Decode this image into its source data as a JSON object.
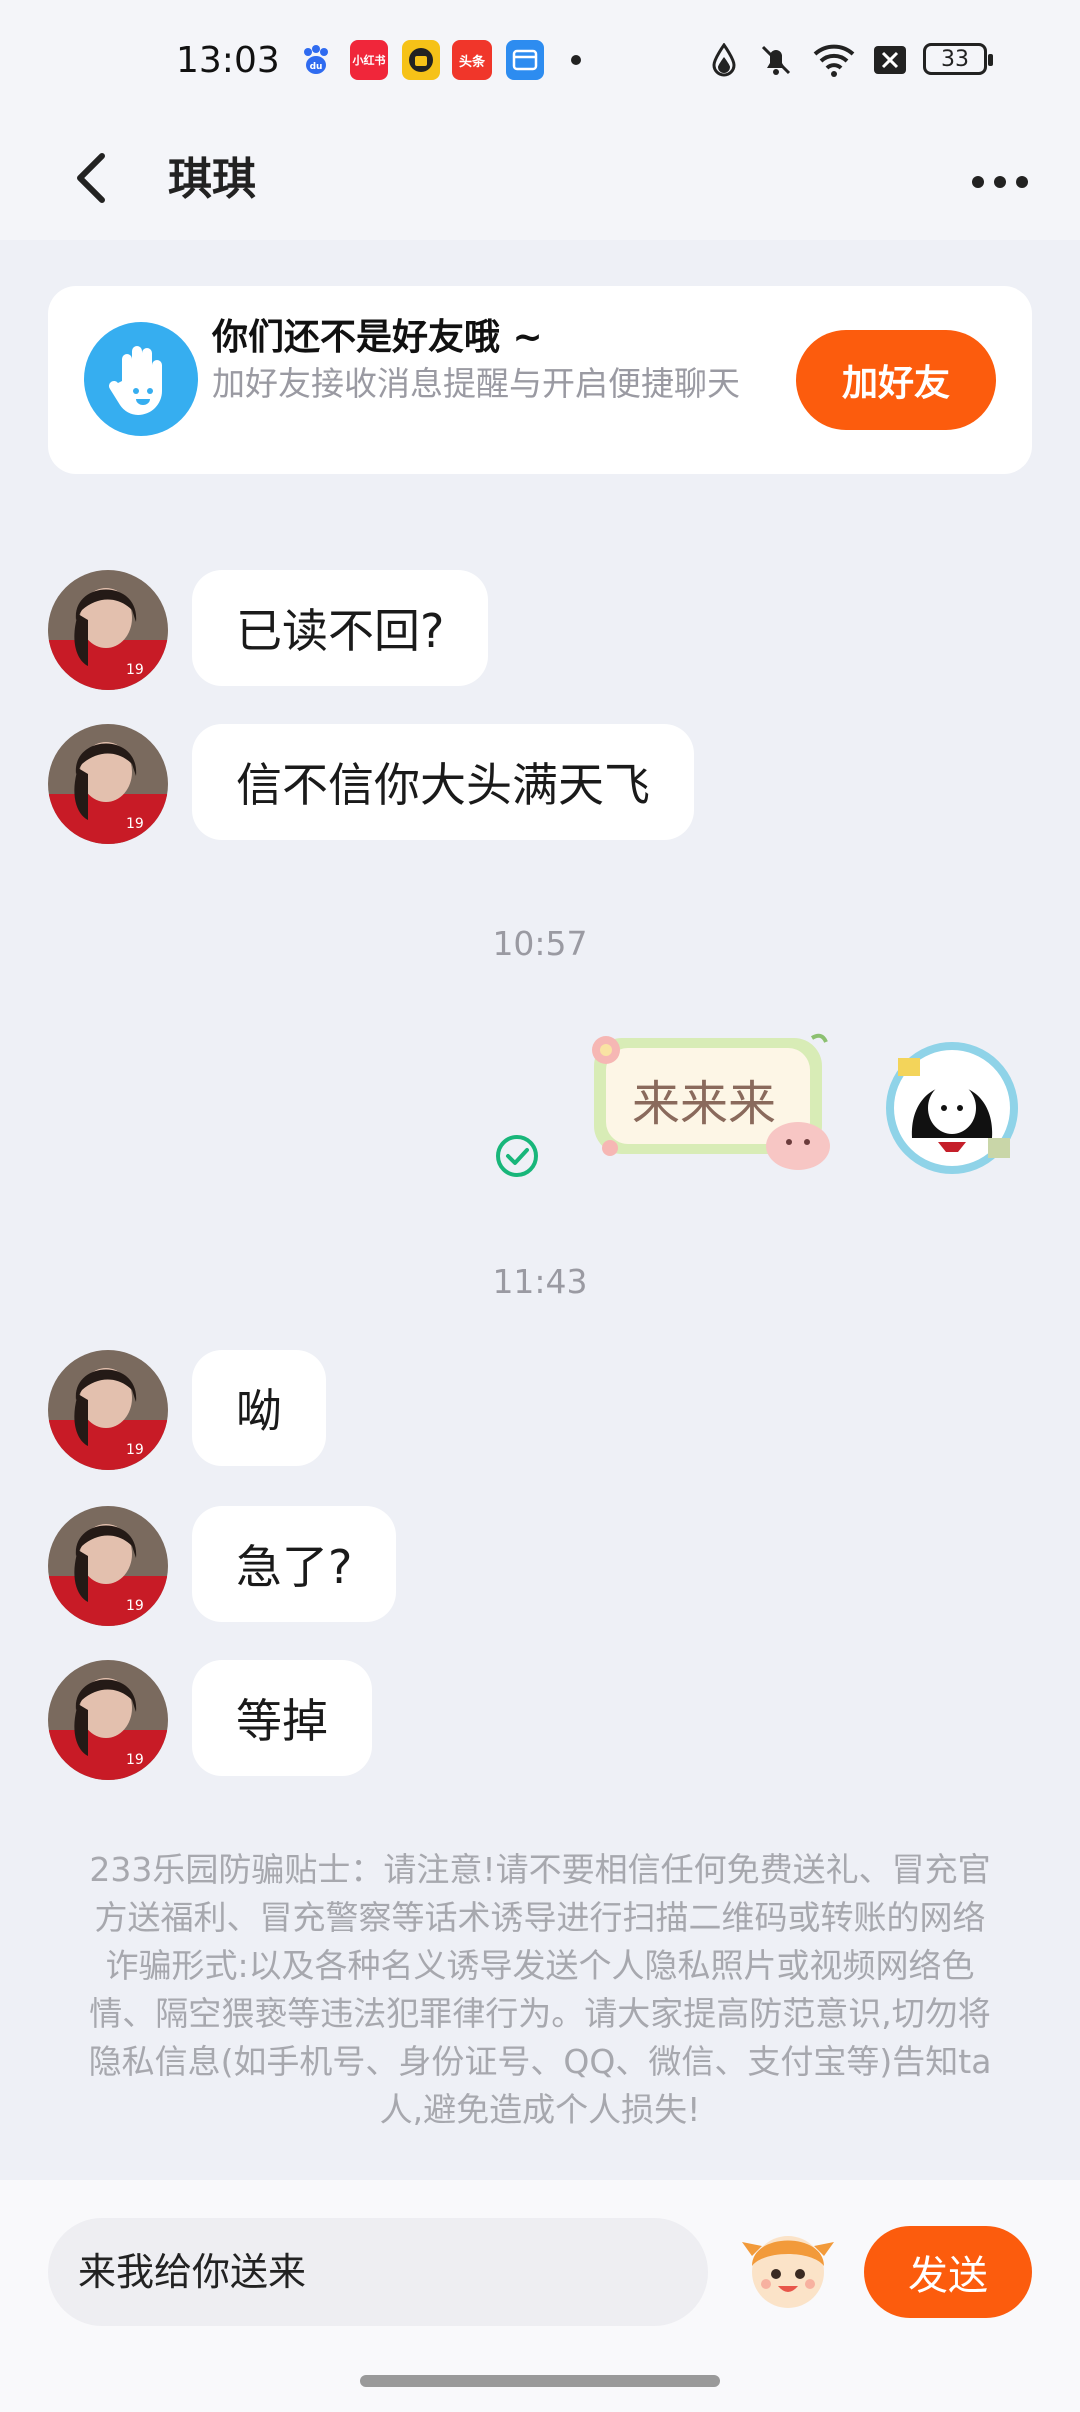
{
  "status": {
    "time": "13:03",
    "notif_xiaohongshu": "小红书",
    "notif_toutiao": "头条",
    "battery": "33"
  },
  "header": {
    "title": "琪琪"
  },
  "friend_card": {
    "title": "你们还不是好友哦 ~",
    "subtitle": "加好友接收消息提醒与开启便捷聊天",
    "add_button": "加好友"
  },
  "messages": [
    {
      "side": "left",
      "text": "已读不回?"
    },
    {
      "side": "left",
      "text": "信不信你大头满天飞"
    },
    {
      "type": "timestamp",
      "text": "10:57"
    },
    {
      "side": "right",
      "type": "sticker",
      "text": "来来来"
    },
    {
      "type": "timestamp",
      "text": "11:43"
    },
    {
      "side": "left",
      "text": "呦"
    },
    {
      "side": "left",
      "text": "急了?"
    },
    {
      "side": "left",
      "text": "等掉"
    }
  ],
  "safety_tips": "233乐园防骗贴士：请注意!请不要相信任何免费送礼、冒充官方送福利、冒充警察等话术诱导进行扫描二维码或转账的网络诈骗形式:以及各种名义诱导发送个人隐私照片或视频网络色情、隔空猥亵等违法犯罪律行为。请大家提高防范意识,切勿将隐私信息(如手机号、身份证号、QQ、微信、支付宝等)告知ta人,避免造成个人损失!",
  "composer": {
    "input_value": "来我给你送来",
    "send_label": "发送"
  },
  "colors": {
    "accent": "#fc5c0d",
    "background": "#eef0f6",
    "bubble": "#ffffff",
    "read_check": "#18b67a"
  }
}
